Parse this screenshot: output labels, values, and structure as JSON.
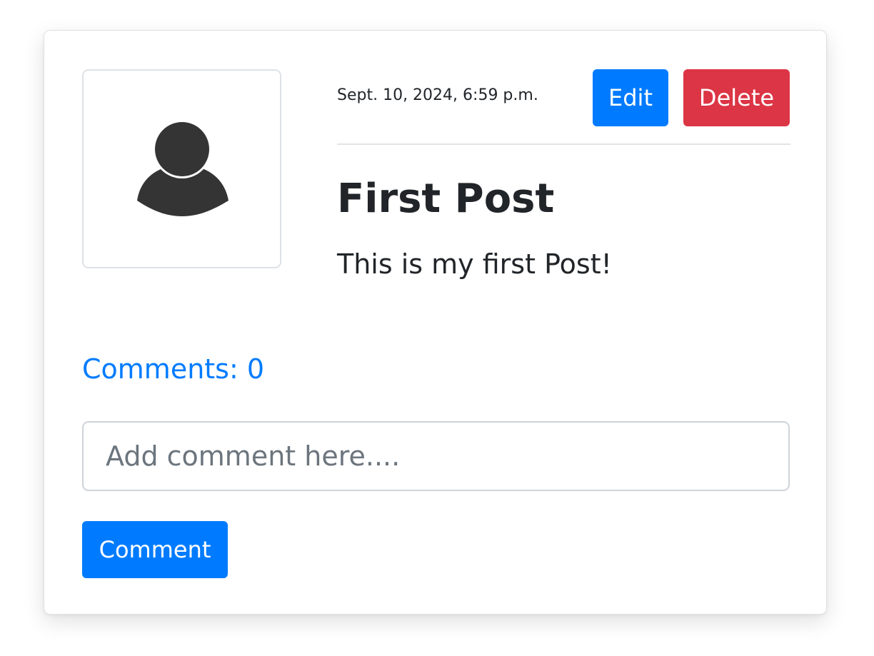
{
  "post": {
    "timestamp": "Sept. 10, 2024, 6:59 p.m.",
    "title": "First Post",
    "body": "This is my first Post!",
    "avatar_icon": "user-icon"
  },
  "actions": {
    "edit_label": "Edit",
    "delete_label": "Delete"
  },
  "comments": {
    "count_label": "Comments: 0",
    "input_placeholder": "Add comment here....",
    "input_value": "",
    "submit_label": "Comment"
  },
  "colors": {
    "primary": "#007bff",
    "danger": "#dc3545",
    "text": "#212529",
    "avatar_fill": "#343434"
  }
}
